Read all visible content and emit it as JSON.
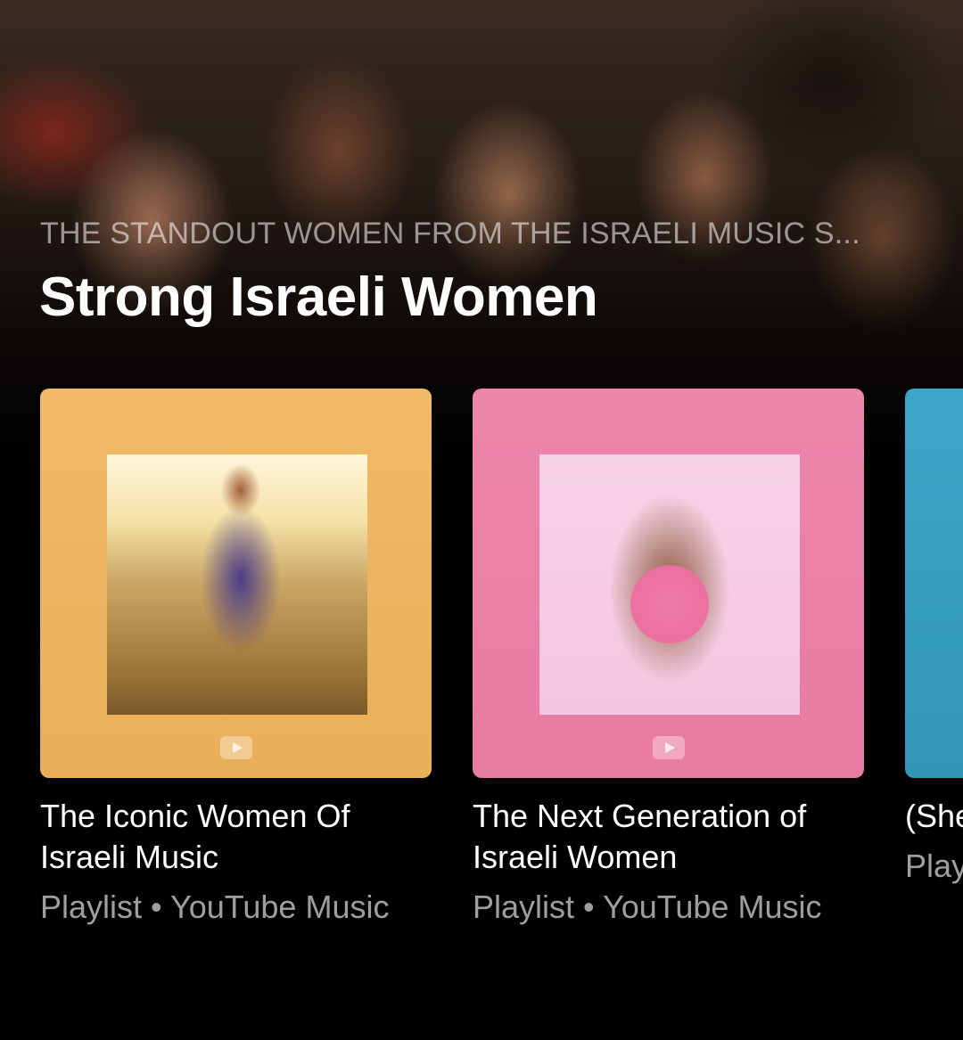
{
  "section": {
    "subtitle": "THE STANDOUT WOMEN FROM THE ISRAELI MUSIC S...",
    "title": "Strong Israeli Women"
  },
  "cards": [
    {
      "title": "The Iconic Women Of Israeli Music",
      "meta": "Playlist • YouTube Music",
      "color": "#EDB45E",
      "art_icon": "youtube-play-icon"
    },
    {
      "title": "The Next Generation of Israeli Women",
      "meta": "Playlist • YouTube Music",
      "color": "#E97FA5",
      "art_icon": "youtube-play-icon"
    },
    {
      "title": "(She",
      "meta": "Play",
      "color": "#3BA2C2"
    }
  ]
}
